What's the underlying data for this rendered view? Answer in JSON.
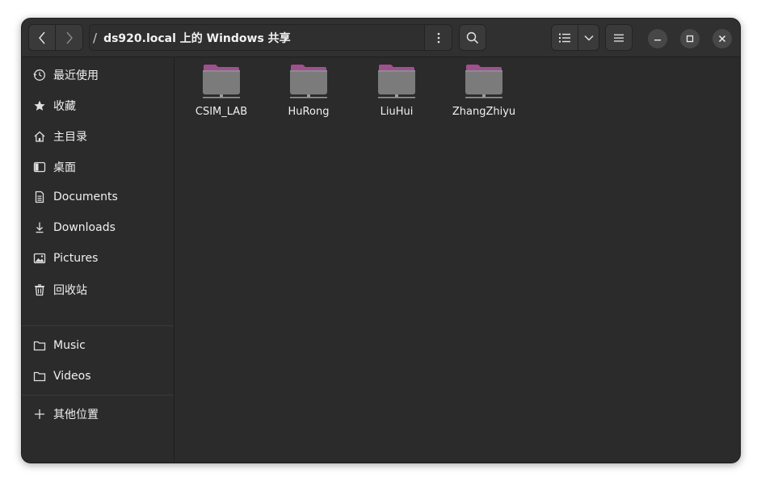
{
  "header": {
    "back_icon": "chevron-left-icon",
    "forward_icon": "chevron-right-icon",
    "path_root": "/",
    "path_current": "ds920.local 上的 Windows 共享",
    "path_menu_icon": "vertical-dots-icon",
    "search_icon": "search-icon",
    "view_icon": "list-view-icon",
    "view_dropdown_icon": "chevron-down-icon",
    "menu_icon": "hamburger-menu-icon",
    "minimize_icon": "minimize-icon",
    "maximize_icon": "maximize-icon",
    "close_icon": "close-icon"
  },
  "sidebar": {
    "items": [
      {
        "label": "最近使用",
        "icon": "clock-icon"
      },
      {
        "label": "收藏",
        "icon": "star-icon"
      },
      {
        "label": "主目录",
        "icon": "home-icon"
      },
      {
        "label": "桌面",
        "icon": "desktop-icon"
      },
      {
        "label": "Documents",
        "icon": "document-icon"
      },
      {
        "label": "Downloads",
        "icon": "download-icon"
      },
      {
        "label": "Pictures",
        "icon": "picture-icon"
      },
      {
        "label": "回收站",
        "icon": "trash-icon"
      },
      {
        "label": "Music",
        "icon": "folder-icon"
      },
      {
        "label": "Videos",
        "icon": "folder-icon"
      },
      {
        "label": "其他位置",
        "icon": "plus-icon"
      }
    ]
  },
  "content": {
    "folders": [
      {
        "name": "CSIM_LAB",
        "icon": "network-folder-icon"
      },
      {
        "name": "HuRong",
        "icon": "network-folder-icon"
      },
      {
        "name": "LiuHui",
        "icon": "network-folder-icon"
      },
      {
        "name": "ZhangZhiyu",
        "icon": "network-folder-icon"
      }
    ]
  },
  "colors": {
    "window_bg": "#2b2b2b",
    "folder_tab": "#a0508f",
    "folder_body": "#7b7b7b"
  }
}
